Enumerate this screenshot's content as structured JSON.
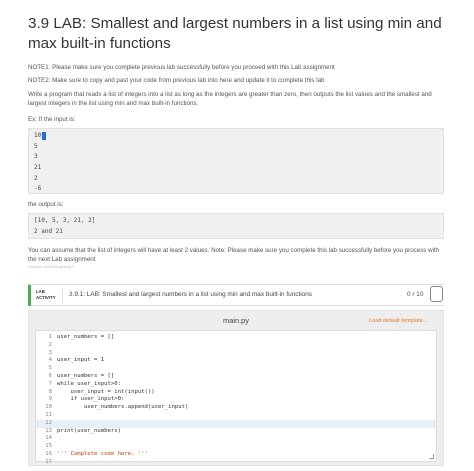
{
  "title": "3.9 LAB: Smallest and largest numbers in a list using min and max built-in functions",
  "note1": "NOTE1: Please make sure you complete previous lab successfully before you proceed with this Lab assignment",
  "note2": "NOTE2: Make sure to copy and past your code from previous lab into here and update it to complete this lab",
  "description": "Write a program that reads a list of integers into a list as long as the integers are greater than zero, then outputs the list values and the smallest and largest integers in the list using min and max built-in functions.",
  "example_intro": "Ex: If the input is:",
  "input_lines": [
    "10",
    "5",
    "3",
    "21",
    "2",
    "-6"
  ],
  "output_intro": "the output is:",
  "output_lines": [
    "[10, 5, 3, 21, 2]",
    "2 and 21"
  ],
  "assume_text": "You can assume that the list of integers will have at least 2 values. Note: Please make sure you complete this lab successfully before you process with the next Lab assignment",
  "tiny_id": "484484.2491108.qx3zqy7",
  "activity": {
    "tag": "LAB ACTIVITY",
    "label": "3.9.1: LAB: Smallest and largest numbers in a list using min and max built-in functions",
    "score": "0 / 10"
  },
  "editor": {
    "filename": "main.py",
    "load_default": "Load default template...",
    "lines": [
      {
        "n": "1",
        "code": "user_numbers = []"
      },
      {
        "n": "2",
        "code": ""
      },
      {
        "n": "3",
        "code": ""
      },
      {
        "n": "4",
        "code": "user_input = 1"
      },
      {
        "n": "5",
        "code": ""
      },
      {
        "n": "6",
        "code": "user_numbers = []"
      },
      {
        "n": "7",
        "code": "while user_input>0:"
      },
      {
        "n": "8",
        "code": "    user_input = int(input())"
      },
      {
        "n": "9",
        "code": "    if user_input>0:"
      },
      {
        "n": "10",
        "code": "        user_numbers.append(user_input)"
      },
      {
        "n": "11",
        "code": ""
      },
      {
        "n": "12",
        "code": ""
      },
      {
        "n": "13",
        "code": "print(user_numbers)"
      },
      {
        "n": "14",
        "code": ""
      },
      {
        "n": "15",
        "code": ""
      },
      {
        "n": "16",
        "code": "''' Complete code here. '''"
      },
      {
        "n": "17",
        "code": ""
      }
    ]
  }
}
